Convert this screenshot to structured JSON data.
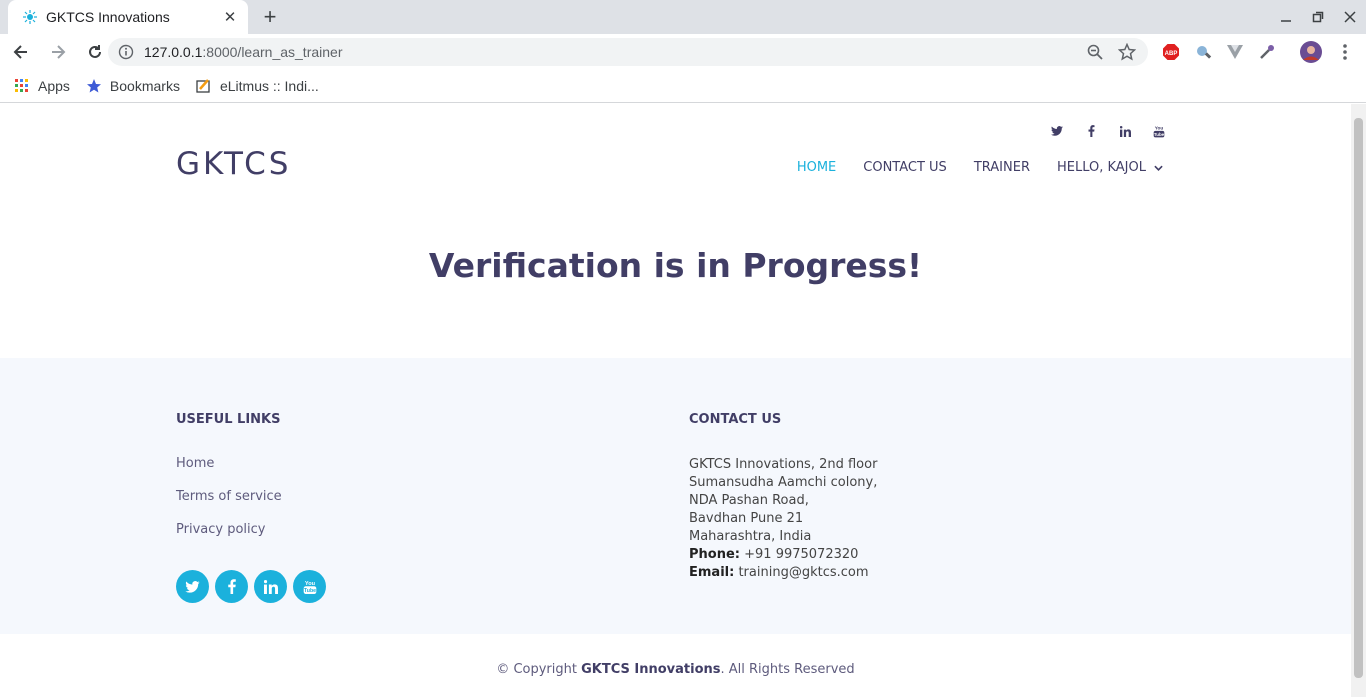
{
  "browser": {
    "tab_title": "GKTCS Innovations",
    "url_host": "127.0.0.1",
    "url_path": ":8000/learn_as_trainer",
    "bookmarks": [
      {
        "label": "Apps",
        "icon": "apps-grid-icon"
      },
      {
        "label": "Bookmarks",
        "icon": "star-icon"
      },
      {
        "label": "eLitmus :: Indi...",
        "icon": "elitmus-favicon"
      }
    ]
  },
  "header": {
    "logo": "GKTCS",
    "nav": [
      {
        "label": "HOME",
        "active": true
      },
      {
        "label": "CONTACT US"
      },
      {
        "label": "TRAINER"
      },
      {
        "label": "HELLO, KAJOL"
      }
    ]
  },
  "hero": {
    "title": "Verification is in Progress!"
  },
  "footer": {
    "useful_links_title": "USEFUL LINKS",
    "links": [
      "Home",
      "Terms of service",
      "Privacy policy"
    ],
    "contact_title": "CONTACT US",
    "address_lines": [
      "GKTCS Innovations, 2nd floor",
      "Sumansudha Aamchi colony,",
      "NDA Pashan Road,",
      "Bavdhan Pune 21",
      "Maharashtra, India"
    ],
    "phone_label": "Phone:",
    "phone": "+91 9975072320",
    "email_label": "Email:",
    "email": "training@gktcs.com"
  },
  "copyright": {
    "prefix": "© Copyright",
    "brand": "GKTCS Innovations",
    "suffix": ". All Rights Reserved"
  },
  "colors": {
    "primary": "#413e66",
    "accent": "#1bb1dc",
    "footer_bg": "#f5f8fd"
  }
}
